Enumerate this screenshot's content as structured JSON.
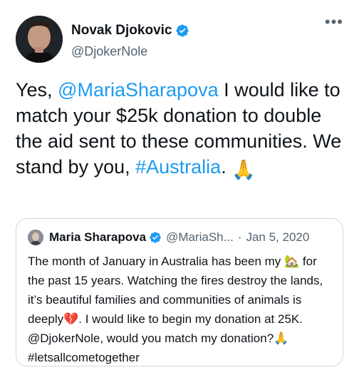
{
  "tweet": {
    "author_name": "Novak Djokovic",
    "author_handle": "@DjokerNole",
    "more_label": "•••",
    "text_part1": "Yes, ",
    "mention": "@MariaSharapova",
    "text_part2": " I would like to match your $25k donation to double the aid sent to these communities. We stand by you, ",
    "hashtag": "#Australia",
    "text_part3": ". ",
    "emoji": "🙏"
  },
  "quote": {
    "author_name": "Maria Sharapova",
    "author_handle": "@MariaSh...",
    "separator": "·",
    "date": "Jan 5, 2020",
    "text_part1": "The month of January in Australia has been my ",
    "emoji_home": "🏡",
    "text_part2": " for the past 15 years. Watching the fires destroy the lands, it’s beautiful families and communities of animals is deeply",
    "emoji_broken": "💔",
    "text_part3": ". I would like to begin my donation at 25K. @DjokerNole, would you match my donation?",
    "emoji_pray": "🙏",
    "text_part4": " #letsallcometogether"
  },
  "colors": {
    "link": "#1d9bf0",
    "verified": "#1d9bf0",
    "secondary_text": "#536471",
    "border": "#cfd9de"
  },
  "icons": {
    "verified": "verified-badge-icon",
    "more": "more-horizontal-icon"
  }
}
